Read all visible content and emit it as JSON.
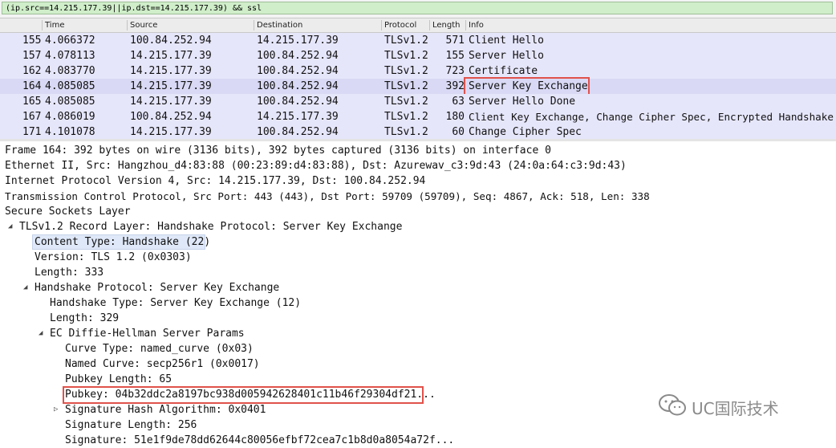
{
  "filter": {
    "value": "(ip.src==14.215.177.39||ip.dst==14.215.177.39) && ssl"
  },
  "packet_list": {
    "columns": [
      "Time",
      "Source",
      "Destination",
      "Protocol",
      "Length",
      "Info"
    ],
    "rows": [
      {
        "no": "155",
        "time": "4.066372",
        "source": "100.84.252.94",
        "destination": "14.215.177.39",
        "protocol": "TLSv1.2",
        "length": "571",
        "info": "Client Hello"
      },
      {
        "no": "157",
        "time": "4.078113",
        "source": "14.215.177.39",
        "destination": "100.84.252.94",
        "protocol": "TLSv1.2",
        "length": "155",
        "info": "Server Hello"
      },
      {
        "no": "162",
        "time": "4.083770",
        "source": "14.215.177.39",
        "destination": "100.84.252.94",
        "protocol": "TLSv1.2",
        "length": "723",
        "info": "Certificate"
      },
      {
        "no": "164",
        "time": "4.085085",
        "source": "14.215.177.39",
        "destination": "100.84.252.94",
        "protocol": "TLSv1.2",
        "length": "392",
        "info": "Server Key Exchange"
      },
      {
        "no": "165",
        "time": "4.085085",
        "source": "14.215.177.39",
        "destination": "100.84.252.94",
        "protocol": "TLSv1.2",
        "length": "63",
        "info": "Server Hello Done"
      },
      {
        "no": "167",
        "time": "4.086019",
        "source": "100.84.252.94",
        "destination": "14.215.177.39",
        "protocol": "TLSv1.2",
        "length": "180",
        "info": "Client Key Exchange, Change Cipher Spec, Encrypted Handshake"
      },
      {
        "no": "171",
        "time": "4.101078",
        "source": "14.215.177.39",
        "destination": "100.84.252.94",
        "protocol": "TLSv1.2",
        "length": "60",
        "info": "Change Cipher Spec"
      }
    ]
  },
  "details": {
    "lines": [
      {
        "text": "Frame 164: 392 bytes on wire (3136 bits), 392 bytes captured (3136 bits) on interface 0",
        "toggle": "none"
      },
      {
        "text": "Ethernet II, Src: Hangzhou_d4:83:88 (00:23:89:d4:83:88), Dst: Azurewav_c3:9d:43 (24:0a:64:c3:9d:43)",
        "toggle": "none"
      },
      {
        "text": "Internet Protocol Version 4, Src: 14.215.177.39, Dst: 100.84.252.94",
        "toggle": "none"
      },
      {
        "text": "Transmission Control Protocol, Src Port: 443 (443), Dst Port: 59709 (59709), Seq: 4867, Ack: 518, Len: 338",
        "toggle": "none"
      },
      {
        "text": "Secure Sockets Layer",
        "toggle": "none"
      },
      {
        "text": "TLSv1.2 Record Layer: Handshake Protocol: Server Key Exchange",
        "toggle": "expanded"
      },
      {
        "text": "Content Type: Handshake (22)",
        "toggle": "none"
      },
      {
        "text": "Version: TLS 1.2 (0x0303)",
        "toggle": "none"
      },
      {
        "text": "Length: 333",
        "toggle": "none"
      },
      {
        "text": "Handshake Protocol: Server Key Exchange",
        "toggle": "expanded"
      },
      {
        "text": "Handshake Type: Server Key Exchange (12)",
        "toggle": "none"
      },
      {
        "text": "Length: 329",
        "toggle": "none"
      },
      {
        "text": "EC Diffie-Hellman Server Params",
        "toggle": "expanded"
      },
      {
        "text": "Curve Type: named_curve (0x03)",
        "toggle": "none"
      },
      {
        "text": "Named Curve: secp256r1 (0x0017)",
        "toggle": "none"
      },
      {
        "text": "Pubkey Length: 65",
        "toggle": "none"
      },
      {
        "text": "Pubkey: 04b32ddc2a8197bc938d005942628401c11b46f29304df21...",
        "toggle": "none"
      },
      {
        "text": "Signature Hash Algorithm: 0x0401",
        "toggle": "collapsed"
      },
      {
        "text": "Signature Length: 256",
        "toggle": "none"
      },
      {
        "text": "Signature: 51e1f9de78dd62644c80056efbf72cea7c1b8d0a8054a72f...",
        "toggle": "none"
      }
    ]
  },
  "watermark": {
    "text": "UC国际技术",
    "icon": "wechat-icon"
  },
  "colors": {
    "row_bg": "#e6e6fb",
    "filter_bg": "#cfeec9",
    "highlight": "#e0524b"
  }
}
